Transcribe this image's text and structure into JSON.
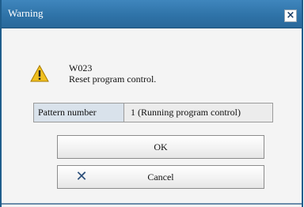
{
  "window": {
    "title": "Warning",
    "close_glyph": "×",
    "close_icon": "close-icon"
  },
  "message": {
    "icon": "warning-icon",
    "code": "W023",
    "text": "Reset program control."
  },
  "info": {
    "label": "Pattern number",
    "value": "1 (Running program control)"
  },
  "buttons": {
    "ok_label": "OK",
    "cancel_label": "Cancel",
    "cancel_icon": "cancel-x-icon",
    "cancel_glyph": "✕"
  },
  "colors": {
    "titlebar": "#2f73a8",
    "warning_fill": "#f0c020",
    "label_bg": "#d9e2eb"
  }
}
